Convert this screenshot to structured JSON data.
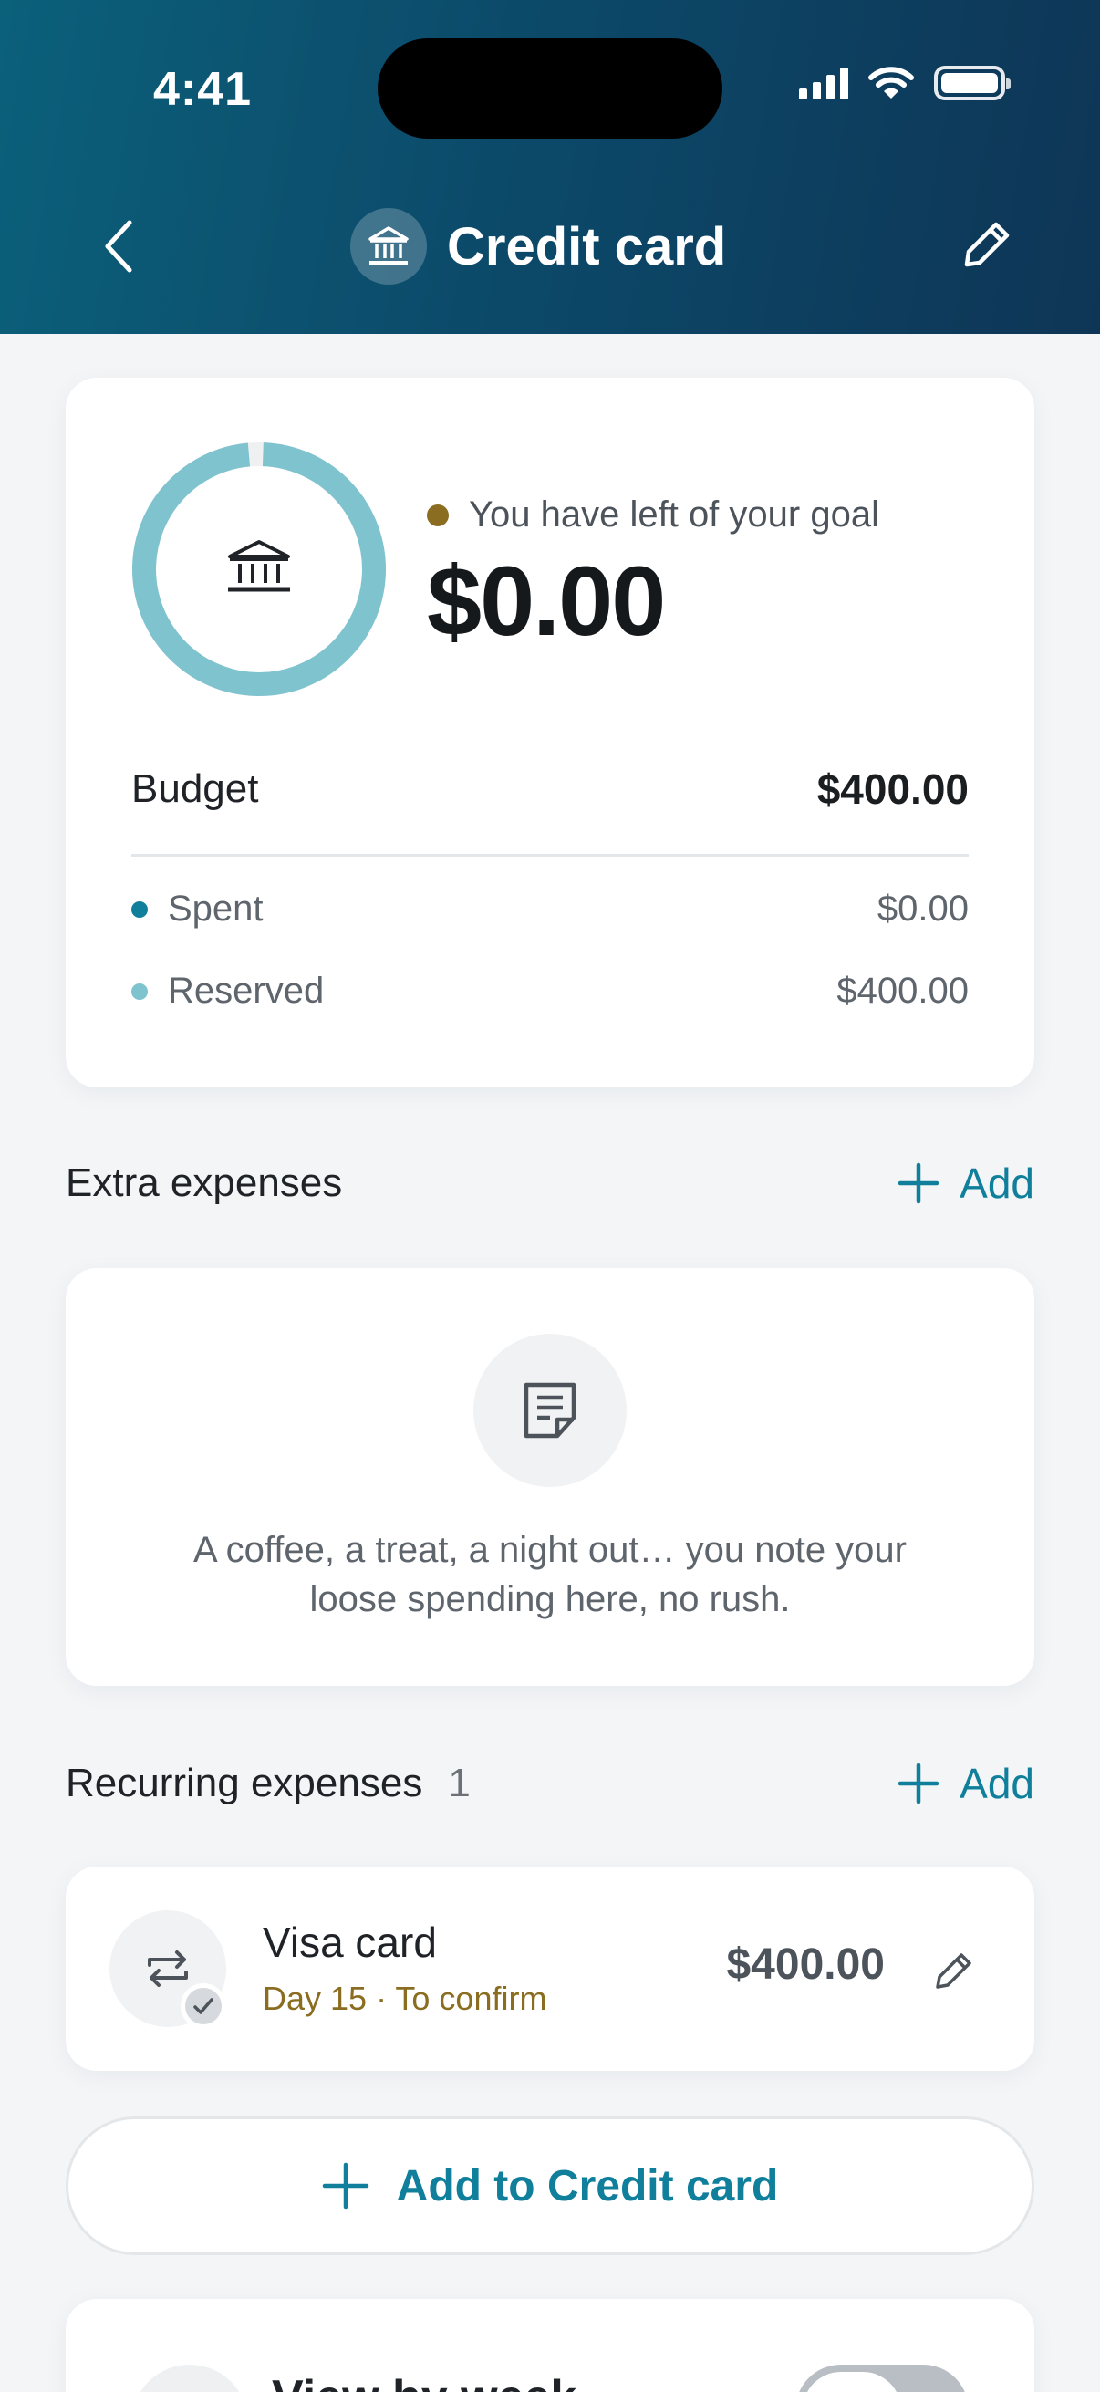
{
  "status_bar": {
    "time": "4:41"
  },
  "nav": {
    "title": "Credit card",
    "back_icon": "chevron-left-icon",
    "edit_icon": "pencil-icon",
    "category_icon": "bank-icon"
  },
  "summary": {
    "goal_label": "You have left of your goal",
    "goal_value": "$0.00",
    "ring_reserved_fraction": 0.98,
    "budget_label": "Budget",
    "budget_value": "$400.00",
    "rows": [
      {
        "label": "Spent",
        "value": "$0.00",
        "color": "#0f7f9b"
      },
      {
        "label": "Reserved",
        "value": "$400.00",
        "color": "#7fc3cf"
      }
    ]
  },
  "extra_expenses": {
    "title": "Extra expenses",
    "add_label": "Add",
    "empty_text": "A coffee, a treat, a night out… you note your loose spending here, no rush."
  },
  "recurring_expenses": {
    "title": "Recurring expenses",
    "count": "1",
    "add_label": "Add",
    "items": [
      {
        "name": "Visa card",
        "meta": "Day 15 · To confirm",
        "amount": "$400.00"
      }
    ]
  },
  "add_button": {
    "label": "Add to Credit card"
  },
  "view_by_week": {
    "label": "View by week",
    "enabled": false
  },
  "colors": {
    "accent": "#0f7f9b",
    "ring": "#7fc3cf",
    "gold": "#8a6d20"
  }
}
